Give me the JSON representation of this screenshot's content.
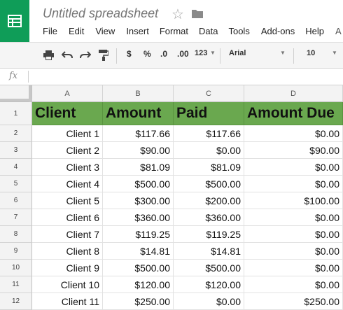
{
  "app": {
    "doc_title": "Untitled spreadsheet",
    "menu": [
      "File",
      "Edit",
      "View",
      "Insert",
      "Format",
      "Data",
      "Tools",
      "Add-ons",
      "Help",
      "A"
    ]
  },
  "toolbar": {
    "currency": "$",
    "percent": "%",
    "decrease_decimals": ".0",
    "increase_decimals": ".00",
    "more_formats": "123",
    "font": "Arial",
    "font_size": "10"
  },
  "formula_bar": {
    "fx_label": "fx",
    "value": ""
  },
  "sheet": {
    "columns": [
      "A",
      "B",
      "C",
      "D"
    ],
    "header_row": [
      "Client",
      "Amount",
      "Paid",
      "Amount Due"
    ],
    "header_color": "#6aa84f",
    "rows": [
      {
        "num": "1"
      },
      {
        "num": "2",
        "cells": [
          "Client 1",
          "$117.66",
          "$117.66",
          "$0.00"
        ]
      },
      {
        "num": "3",
        "cells": [
          "Client 2",
          "$90.00",
          "$0.00",
          "$90.00"
        ]
      },
      {
        "num": "4",
        "cells": [
          "Client 3",
          "$81.09",
          "$81.09",
          "$0.00"
        ]
      },
      {
        "num": "5",
        "cells": [
          "Client 4",
          "$500.00",
          "$500.00",
          "$0.00"
        ]
      },
      {
        "num": "6",
        "cells": [
          "Client 5",
          "$300.00",
          "$200.00",
          "$100.00"
        ]
      },
      {
        "num": "7",
        "cells": [
          "Client 6",
          "$360.00",
          "$360.00",
          "$0.00"
        ]
      },
      {
        "num": "8",
        "cells": [
          "Client 7",
          "$119.25",
          "$119.25",
          "$0.00"
        ]
      },
      {
        "num": "9",
        "cells": [
          "Client 8",
          "$14.81",
          "$14.81",
          "$0.00"
        ]
      },
      {
        "num": "10",
        "cells": [
          "Client 9",
          "$500.00",
          "$500.00",
          "$0.00"
        ]
      },
      {
        "num": "11",
        "cells": [
          "Client 10",
          "$120.00",
          "$120.00",
          "$0.00"
        ]
      },
      {
        "num": "12",
        "cells": [
          "Client 11",
          "$250.00",
          "$0.00",
          "$250.00"
        ]
      }
    ]
  }
}
